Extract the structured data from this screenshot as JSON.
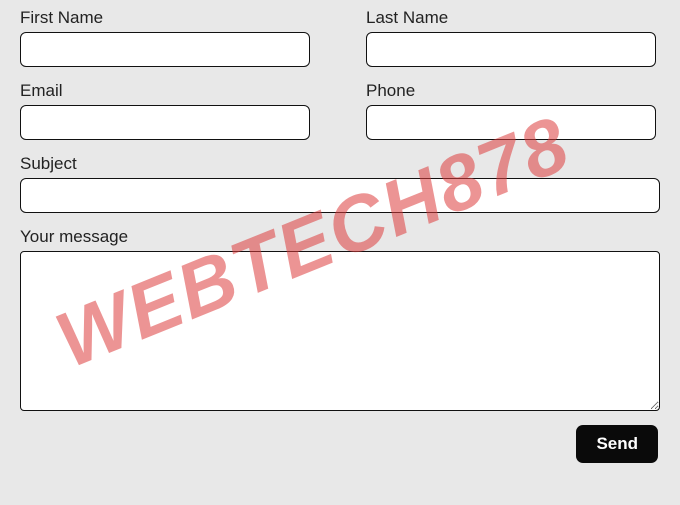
{
  "watermark": "WEBTECH878",
  "form": {
    "first_name": {
      "label": "First Name",
      "value": ""
    },
    "last_name": {
      "label": "Last Name",
      "value": ""
    },
    "email": {
      "label": "Email",
      "value": ""
    },
    "phone": {
      "label": "Phone",
      "value": ""
    },
    "subject": {
      "label": "Subject",
      "value": ""
    },
    "message": {
      "label": "Your message",
      "value": ""
    },
    "send_label": "Send"
  }
}
